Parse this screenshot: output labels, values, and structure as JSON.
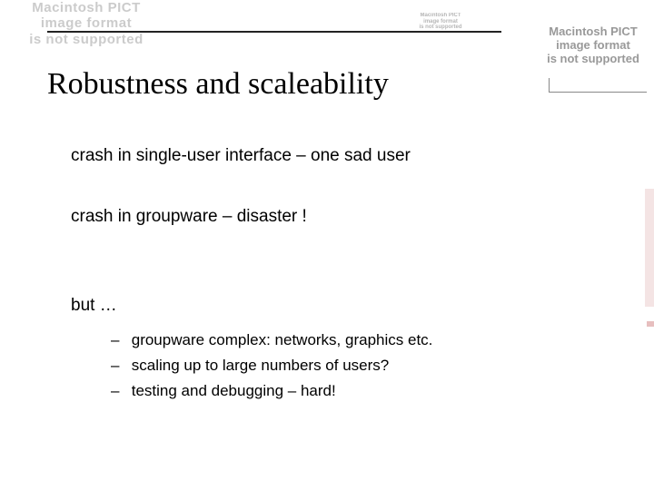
{
  "pict_error": {
    "line1": "Macintosh PICT",
    "line2": "image format",
    "line3": "is not supported"
  },
  "title": "Robustness and scaleability",
  "body": {
    "p1": "crash in single-user interface – one sad user",
    "p2": "crash in groupware – disaster !",
    "p3": "but …"
  },
  "sublist": [
    "groupware complex: networks, graphics etc.",
    "scaling up to large numbers of users?",
    "testing and debugging – hard!"
  ],
  "dash": "–"
}
